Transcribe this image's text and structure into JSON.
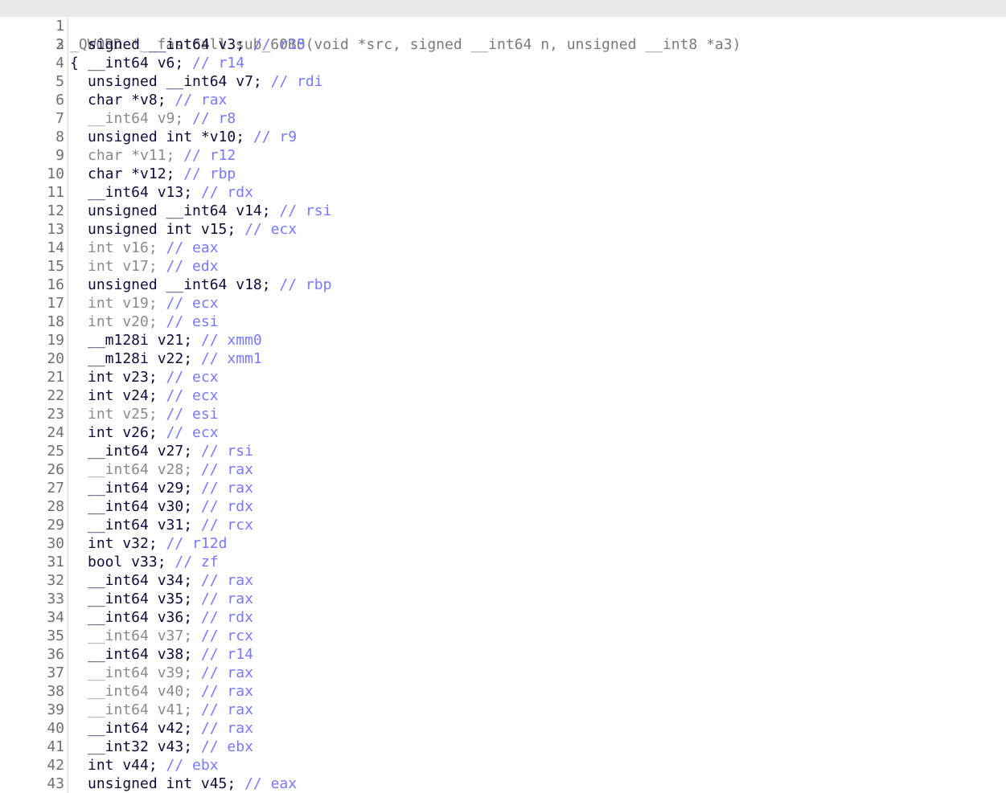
{
  "editor": {
    "header_line": {
      "number": "1",
      "text": "_QWORD *__fastcall sub_60B0(void *src, signed __int64 n, unsigned __int8 *a3)"
    },
    "brace_line": {
      "number": "2",
      "text": "{"
    },
    "declarations": [
      {
        "number": "3",
        "decl": "signed __int64 v3; ",
        "comment": "// r15",
        "dim": false
      },
      {
        "number": "4",
        "decl": "__int64 v6; ",
        "comment": "// r14",
        "dim": false
      },
      {
        "number": "5",
        "decl": "unsigned __int64 v7; ",
        "comment": "// rdi",
        "dim": false
      },
      {
        "number": "6",
        "decl": "char *v8; ",
        "comment": "// rax",
        "dim": false
      },
      {
        "number": "7",
        "decl": "__int64 v9; ",
        "comment": "// r8",
        "dim": true
      },
      {
        "number": "8",
        "decl": "unsigned int *v10; ",
        "comment": "// r9",
        "dim": false
      },
      {
        "number": "9",
        "decl": "char *v11; ",
        "comment": "// r12",
        "dim": true
      },
      {
        "number": "10",
        "decl": "char *v12; ",
        "comment": "// rbp",
        "dim": false
      },
      {
        "number": "11",
        "decl": "__int64 v13; ",
        "comment": "// rdx",
        "dim": false
      },
      {
        "number": "12",
        "decl": "unsigned __int64 v14; ",
        "comment": "// rsi",
        "dim": false
      },
      {
        "number": "13",
        "decl": "unsigned int v15; ",
        "comment": "// ecx",
        "dim": false
      },
      {
        "number": "14",
        "decl": "int v16; ",
        "comment": "// eax",
        "dim": true
      },
      {
        "number": "15",
        "decl": "int v17; ",
        "comment": "// edx",
        "dim": true
      },
      {
        "number": "16",
        "decl": "unsigned __int64 v18; ",
        "comment": "// rbp",
        "dim": false
      },
      {
        "number": "17",
        "decl": "int v19; ",
        "comment": "// ecx",
        "dim": true
      },
      {
        "number": "18",
        "decl": "int v20; ",
        "comment": "// esi",
        "dim": true
      },
      {
        "number": "19",
        "decl": "__m128i v21; ",
        "comment": "// xmm0",
        "dim": false
      },
      {
        "number": "20",
        "decl": "__m128i v22; ",
        "comment": "// xmm1",
        "dim": false
      },
      {
        "number": "21",
        "decl": "int v23; ",
        "comment": "// ecx",
        "dim": false
      },
      {
        "number": "22",
        "decl": "int v24; ",
        "comment": "// ecx",
        "dim": false
      },
      {
        "number": "23",
        "decl": "int v25; ",
        "comment": "// esi",
        "dim": true
      },
      {
        "number": "24",
        "decl": "int v26; ",
        "comment": "// ecx",
        "dim": false
      },
      {
        "number": "25",
        "decl": "__int64 v27; ",
        "comment": "// rsi",
        "dim": false
      },
      {
        "number": "26",
        "decl": "__int64 v28; ",
        "comment": "// rax",
        "dim": true
      },
      {
        "number": "27",
        "decl": "__int64 v29; ",
        "comment": "// rax",
        "dim": false
      },
      {
        "number": "28",
        "decl": "__int64 v30; ",
        "comment": "// rdx",
        "dim": false
      },
      {
        "number": "29",
        "decl": "__int64 v31; ",
        "comment": "// rcx",
        "dim": false
      },
      {
        "number": "30",
        "decl": "int v32; ",
        "comment": "// r12d",
        "dim": false
      },
      {
        "number": "31",
        "decl": "bool v33; ",
        "comment": "// zf",
        "dim": false
      },
      {
        "number": "32",
        "decl": "__int64 v34; ",
        "comment": "// rax",
        "dim": false
      },
      {
        "number": "33",
        "decl": "__int64 v35; ",
        "comment": "// rax",
        "dim": false
      },
      {
        "number": "34",
        "decl": "__int64 v36; ",
        "comment": "// rdx",
        "dim": false
      },
      {
        "number": "35",
        "decl": "__int64 v37; ",
        "comment": "// rcx",
        "dim": true
      },
      {
        "number": "36",
        "decl": "__int64 v38; ",
        "comment": "// r14",
        "dim": false
      },
      {
        "number": "37",
        "decl": "__int64 v39; ",
        "comment": "// rax",
        "dim": true
      },
      {
        "number": "38",
        "decl": "__int64 v40; ",
        "comment": "// rax",
        "dim": true
      },
      {
        "number": "39",
        "decl": "__int64 v41; ",
        "comment": "// rax",
        "dim": true
      },
      {
        "number": "40",
        "decl": "__int64 v42; ",
        "comment": "// rax",
        "dim": false
      },
      {
        "number": "41",
        "decl": "__int32 v43; ",
        "comment": "// ebx",
        "dim": false
      },
      {
        "number": "42",
        "decl": "int v44; ",
        "comment": "// ebx",
        "dim": false
      },
      {
        "number": "43",
        "decl": "unsigned int v45; ",
        "comment": "// eax",
        "dim": false
      }
    ]
  },
  "colors": {
    "code": "#0c0c3a",
    "dim_code": "#8a8a8a",
    "comment": "#7777ff",
    "line_number": "#6f6f6f",
    "current_line_highlight": "#eaeaea"
  }
}
